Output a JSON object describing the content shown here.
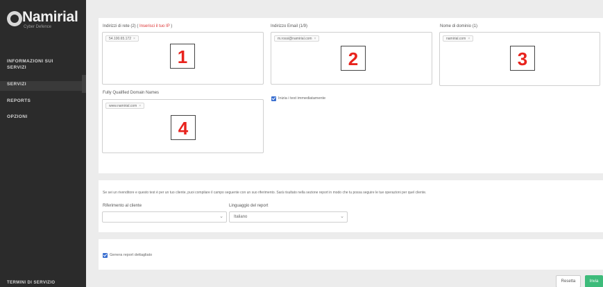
{
  "brand": {
    "name": "Namirial",
    "tagline": "Cyber Defence"
  },
  "sidebar": {
    "items": [
      {
        "label": "INFORMAZIONI SUI"
      },
      {
        "label": "SERVIZI"
      },
      {
        "label": "SERVIZI"
      },
      {
        "label": "REPORTS"
      },
      {
        "label": "OPZIONI"
      }
    ],
    "footer": "TERMINI DI SERVIZIO"
  },
  "fields": {
    "network": {
      "label": "Indirizzi di rete (2)",
      "warn": "Inserisci il tuo IP",
      "tag": "54.100.65.172",
      "marker": "1"
    },
    "email": {
      "label": "Indirizzo Email (1/9)",
      "tag": "m.rossi@namirial.com",
      "marker": "2"
    },
    "domain": {
      "label": "Nome di dominio (1)",
      "tag": "namirial.com",
      "marker": "3"
    },
    "fqdn": {
      "label": "Fully Qualified Domain Names",
      "tag": "www.namirial.com",
      "marker": "4"
    }
  },
  "start_now": {
    "label": "Inizia i test immediatamente",
    "checked": true
  },
  "reseller_note": "Se sei un rivenditore e questo test è per un tuo cliente, puoi compilare il campo seguente con un suo riferimento. Sarà risultato nella sezione report in modo che tu possa seguire le tue operazioni per quel cliente.",
  "client_ref": {
    "label": "Riferimento al cliente",
    "value": ""
  },
  "report_lang": {
    "label": "Linguaggio del report",
    "value": "Italiano"
  },
  "detailed_report": {
    "label": "Genera report dettagliato",
    "checked": true
  },
  "actions": {
    "reset": "Resetta",
    "send": "Invia"
  }
}
